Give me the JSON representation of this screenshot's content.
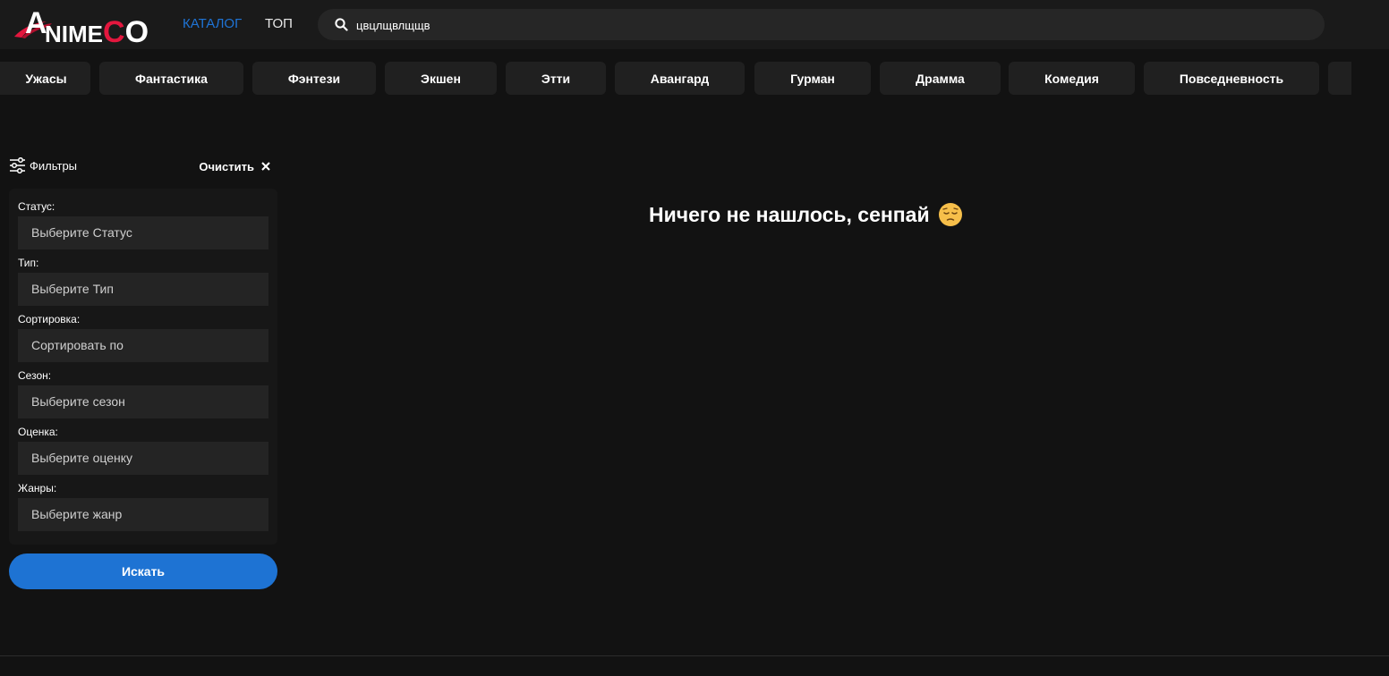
{
  "header": {
    "logo_text_a": "A",
    "logo_text_mid": "NIME",
    "logo_text_c": "C",
    "logo_text_o": "O",
    "nav": [
      {
        "label": "КАТАЛОГ",
        "active": true
      },
      {
        "label": "ТОП",
        "active": false
      }
    ],
    "search": {
      "value": "цвцлщвлщщв",
      "icon": "search-icon"
    }
  },
  "genres": [
    "Ужасы",
    "Фантастика",
    "Фэнтези",
    "Экшен",
    "Этти",
    "Авангард",
    "Гурман",
    "Драмма",
    "Комедия",
    "Повседневность"
  ],
  "filters": {
    "title": "Фильтры",
    "clear_label": "Очистить",
    "fields": [
      {
        "label": "Статус:",
        "placeholder": "Выберите Статус"
      },
      {
        "label": "Тип:",
        "placeholder": "Выберите Тип"
      },
      {
        "label": "Сортировка:",
        "placeholder": "Сортировать по"
      },
      {
        "label": "Сезон:",
        "placeholder": "Выберите сезон"
      },
      {
        "label": "Оценка:",
        "placeholder": "Выберите оценку"
      },
      {
        "label": "Жанры:",
        "placeholder": "Выберите жанр"
      }
    ],
    "submit_label": "Искать"
  },
  "results": {
    "empty_message": "Ничего не нашлось, сенпай",
    "empty_emoji": "pensive-face-icon"
  },
  "colors": {
    "accent_blue": "#1e73d3",
    "brand_red": "#e3173e",
    "background": "#121212"
  }
}
